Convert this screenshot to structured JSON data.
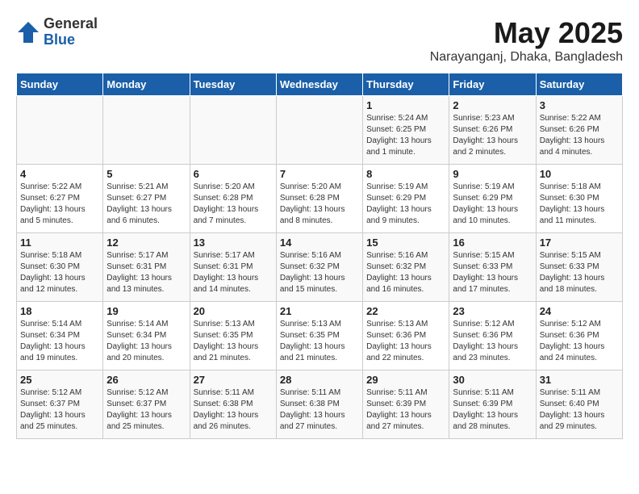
{
  "header": {
    "logo_general": "General",
    "logo_blue": "Blue",
    "month_title": "May 2025",
    "location": "Narayanganj, Dhaka, Bangladesh"
  },
  "weekdays": [
    "Sunday",
    "Monday",
    "Tuesday",
    "Wednesday",
    "Thursday",
    "Friday",
    "Saturday"
  ],
  "weeks": [
    [
      {
        "day": "",
        "info": ""
      },
      {
        "day": "",
        "info": ""
      },
      {
        "day": "",
        "info": ""
      },
      {
        "day": "",
        "info": ""
      },
      {
        "day": "1",
        "info": "Sunrise: 5:24 AM\nSunset: 6:25 PM\nDaylight: 13 hours\nand 1 minute."
      },
      {
        "day": "2",
        "info": "Sunrise: 5:23 AM\nSunset: 6:26 PM\nDaylight: 13 hours\nand 2 minutes."
      },
      {
        "day": "3",
        "info": "Sunrise: 5:22 AM\nSunset: 6:26 PM\nDaylight: 13 hours\nand 4 minutes."
      }
    ],
    [
      {
        "day": "4",
        "info": "Sunrise: 5:22 AM\nSunset: 6:27 PM\nDaylight: 13 hours\nand 5 minutes."
      },
      {
        "day": "5",
        "info": "Sunrise: 5:21 AM\nSunset: 6:27 PM\nDaylight: 13 hours\nand 6 minutes."
      },
      {
        "day": "6",
        "info": "Sunrise: 5:20 AM\nSunset: 6:28 PM\nDaylight: 13 hours\nand 7 minutes."
      },
      {
        "day": "7",
        "info": "Sunrise: 5:20 AM\nSunset: 6:28 PM\nDaylight: 13 hours\nand 8 minutes."
      },
      {
        "day": "8",
        "info": "Sunrise: 5:19 AM\nSunset: 6:29 PM\nDaylight: 13 hours\nand 9 minutes."
      },
      {
        "day": "9",
        "info": "Sunrise: 5:19 AM\nSunset: 6:29 PM\nDaylight: 13 hours\nand 10 minutes."
      },
      {
        "day": "10",
        "info": "Sunrise: 5:18 AM\nSunset: 6:30 PM\nDaylight: 13 hours\nand 11 minutes."
      }
    ],
    [
      {
        "day": "11",
        "info": "Sunrise: 5:18 AM\nSunset: 6:30 PM\nDaylight: 13 hours\nand 12 minutes."
      },
      {
        "day": "12",
        "info": "Sunrise: 5:17 AM\nSunset: 6:31 PM\nDaylight: 13 hours\nand 13 minutes."
      },
      {
        "day": "13",
        "info": "Sunrise: 5:17 AM\nSunset: 6:31 PM\nDaylight: 13 hours\nand 14 minutes."
      },
      {
        "day": "14",
        "info": "Sunrise: 5:16 AM\nSunset: 6:32 PM\nDaylight: 13 hours\nand 15 minutes."
      },
      {
        "day": "15",
        "info": "Sunrise: 5:16 AM\nSunset: 6:32 PM\nDaylight: 13 hours\nand 16 minutes."
      },
      {
        "day": "16",
        "info": "Sunrise: 5:15 AM\nSunset: 6:33 PM\nDaylight: 13 hours\nand 17 minutes."
      },
      {
        "day": "17",
        "info": "Sunrise: 5:15 AM\nSunset: 6:33 PM\nDaylight: 13 hours\nand 18 minutes."
      }
    ],
    [
      {
        "day": "18",
        "info": "Sunrise: 5:14 AM\nSunset: 6:34 PM\nDaylight: 13 hours\nand 19 minutes."
      },
      {
        "day": "19",
        "info": "Sunrise: 5:14 AM\nSunset: 6:34 PM\nDaylight: 13 hours\nand 20 minutes."
      },
      {
        "day": "20",
        "info": "Sunrise: 5:13 AM\nSunset: 6:35 PM\nDaylight: 13 hours\nand 21 minutes."
      },
      {
        "day": "21",
        "info": "Sunrise: 5:13 AM\nSunset: 6:35 PM\nDaylight: 13 hours\nand 21 minutes."
      },
      {
        "day": "22",
        "info": "Sunrise: 5:13 AM\nSunset: 6:36 PM\nDaylight: 13 hours\nand 22 minutes."
      },
      {
        "day": "23",
        "info": "Sunrise: 5:12 AM\nSunset: 6:36 PM\nDaylight: 13 hours\nand 23 minutes."
      },
      {
        "day": "24",
        "info": "Sunrise: 5:12 AM\nSunset: 6:36 PM\nDaylight: 13 hours\nand 24 minutes."
      }
    ],
    [
      {
        "day": "25",
        "info": "Sunrise: 5:12 AM\nSunset: 6:37 PM\nDaylight: 13 hours\nand 25 minutes."
      },
      {
        "day": "26",
        "info": "Sunrise: 5:12 AM\nSunset: 6:37 PM\nDaylight: 13 hours\nand 25 minutes."
      },
      {
        "day": "27",
        "info": "Sunrise: 5:11 AM\nSunset: 6:38 PM\nDaylight: 13 hours\nand 26 minutes."
      },
      {
        "day": "28",
        "info": "Sunrise: 5:11 AM\nSunset: 6:38 PM\nDaylight: 13 hours\nand 27 minutes."
      },
      {
        "day": "29",
        "info": "Sunrise: 5:11 AM\nSunset: 6:39 PM\nDaylight: 13 hours\nand 27 minutes."
      },
      {
        "day": "30",
        "info": "Sunrise: 5:11 AM\nSunset: 6:39 PM\nDaylight: 13 hours\nand 28 minutes."
      },
      {
        "day": "31",
        "info": "Sunrise: 5:11 AM\nSunset: 6:40 PM\nDaylight: 13 hours\nand 29 minutes."
      }
    ]
  ]
}
